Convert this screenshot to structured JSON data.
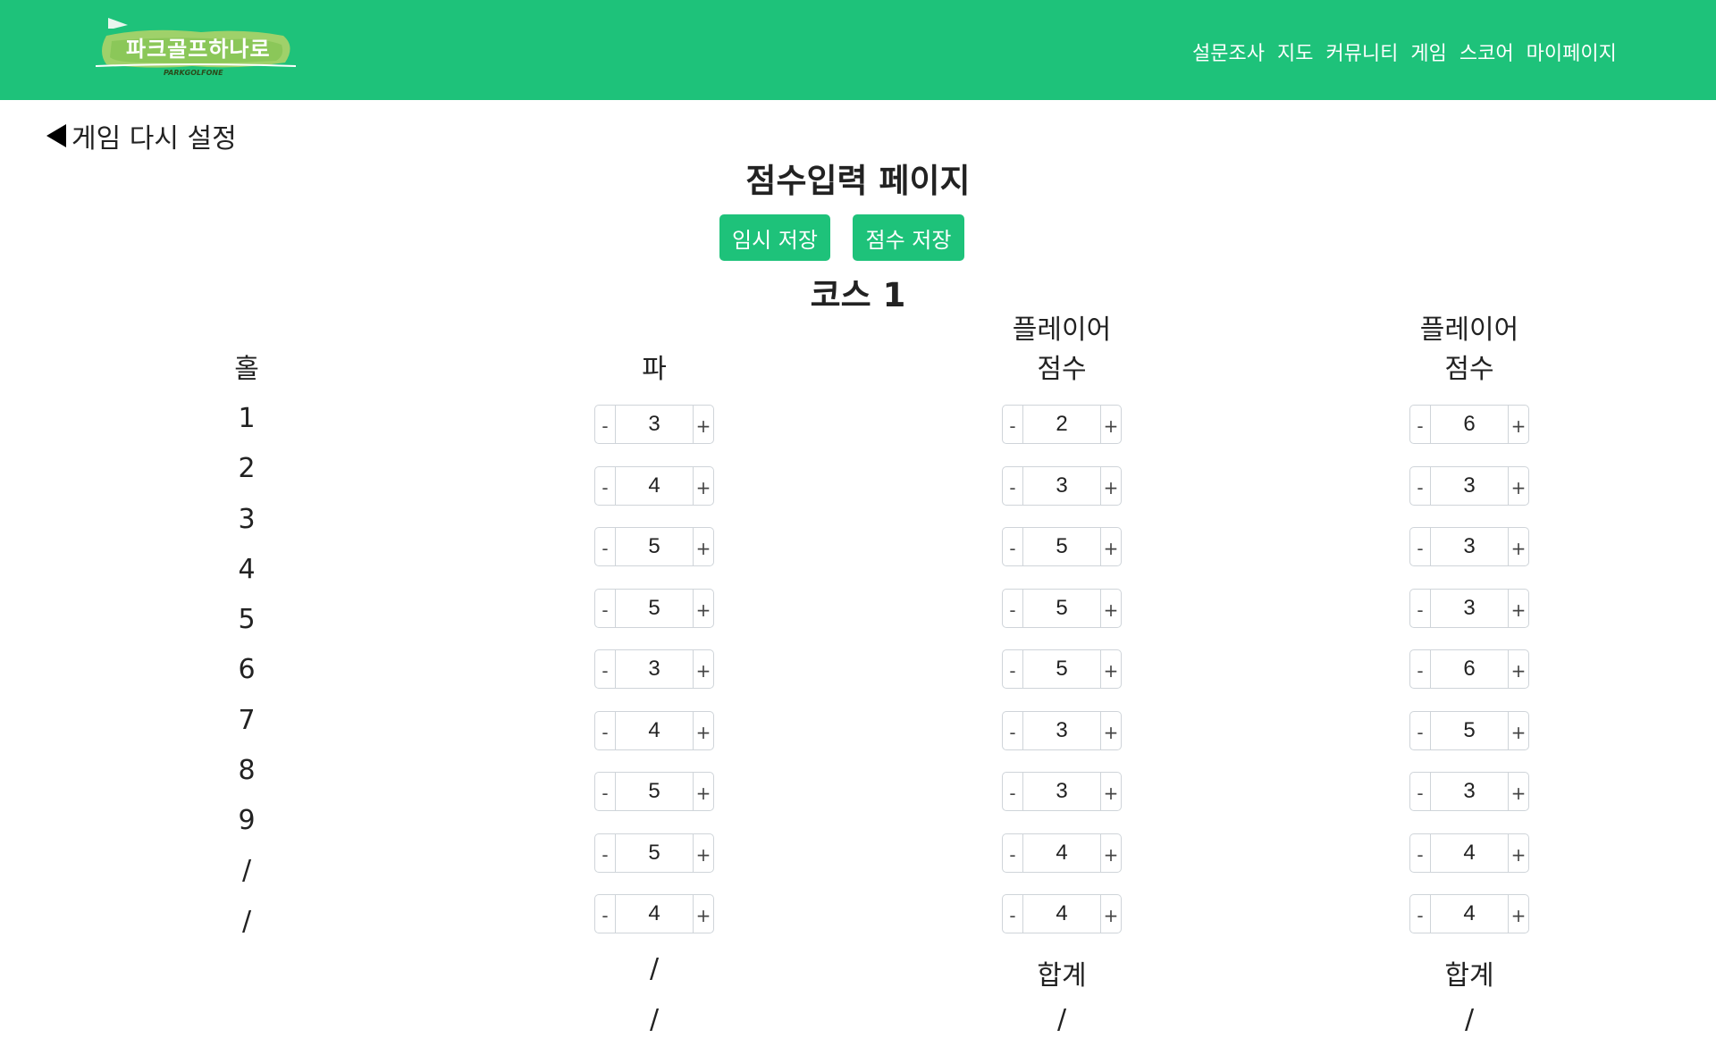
{
  "brand": {
    "name": "파크골프하나로",
    "sub": "PARKGOLFONE",
    "color": "#1ec27a"
  },
  "nav": [
    {
      "label": "설문조사"
    },
    {
      "label": "지도"
    },
    {
      "label": "커뮤니티"
    },
    {
      "label": "게임"
    },
    {
      "label": "스코어"
    },
    {
      "label": "마이페이지"
    }
  ],
  "back": {
    "label": "게임 다시 설정"
  },
  "title": "점수입력 페이지",
  "buttons": {
    "temp_save": "임시 저장",
    "save": "점수 저장"
  },
  "course": "코스 1",
  "columns": {
    "hole": "홀",
    "par": "파",
    "player1": {
      "line1": "플레이어",
      "line2": "점수"
    },
    "player2": {
      "line1": "플레이어",
      "line2": "점수"
    }
  },
  "holes": [
    "1",
    "2",
    "3",
    "4",
    "5",
    "6",
    "7",
    "8",
    "9",
    "/",
    "/"
  ],
  "stepper": {
    "dec": "-",
    "inc": "+"
  },
  "par_values": [
    "3",
    "4",
    "5",
    "5",
    "3",
    "4",
    "5",
    "5",
    "4"
  ],
  "player1_scores": [
    "2",
    "3",
    "5",
    "5",
    "5",
    "3",
    "3",
    "4",
    "4"
  ],
  "player2_scores": [
    "6",
    "3",
    "3",
    "3",
    "6",
    "5",
    "3",
    "4",
    "4"
  ],
  "footer": {
    "par_row1": "/",
    "par_row2": "/",
    "p1_sum_label": "합계",
    "p1_sum": "/",
    "p2_sum_label": "합계",
    "p2_sum": "/"
  }
}
